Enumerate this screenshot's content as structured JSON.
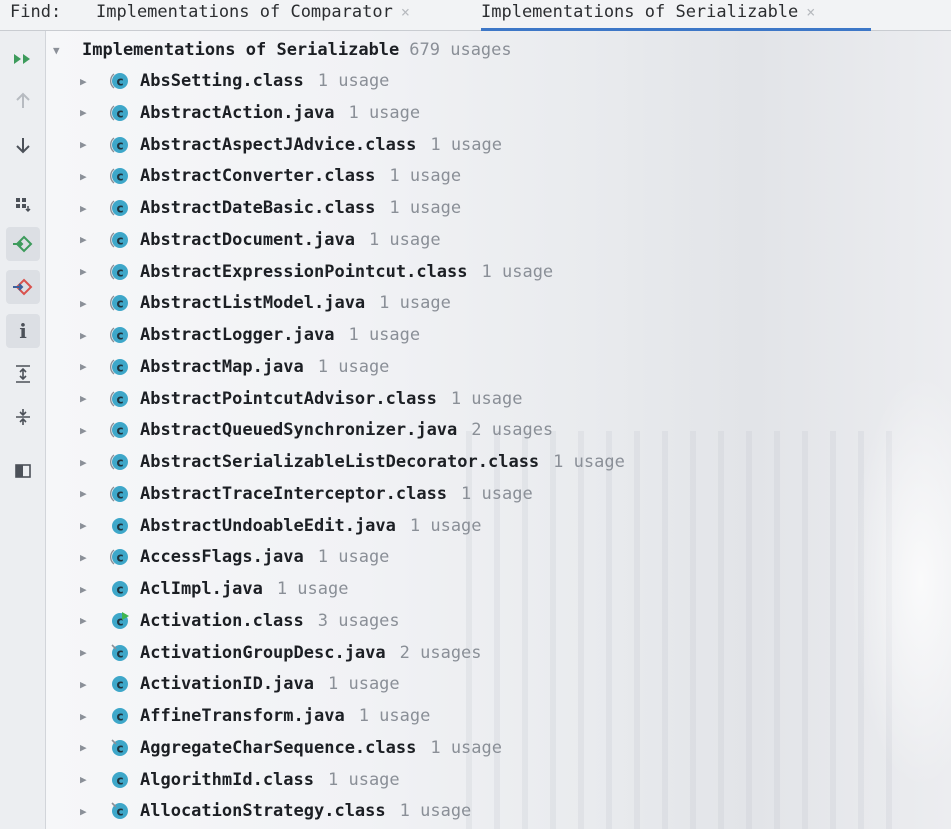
{
  "header": {
    "find_label": "Find:",
    "tabs": [
      {
        "label": "Implementations of Comparator",
        "close": "×",
        "active": false
      },
      {
        "label": "Implementations of Serializable",
        "close": "×",
        "active": true
      }
    ]
  },
  "toolbar": {
    "buttons": [
      {
        "name": "expand-all-icon",
        "toggled": false
      },
      {
        "name": "previous-occurrence-icon",
        "toggled": false
      },
      {
        "name": "next-occurrence-icon",
        "toggled": false
      },
      {
        "name": "group-by-icon",
        "toggled": false
      },
      {
        "name": "show-read-access-icon",
        "toggled": true
      },
      {
        "name": "show-write-access-icon",
        "toggled": true
      },
      {
        "name": "info-icon",
        "toggled": true
      },
      {
        "name": "expand-tree-icon",
        "toggled": false
      },
      {
        "name": "collapse-tree-icon",
        "toggled": false
      },
      {
        "name": "preview-icon",
        "toggled": false
      }
    ]
  },
  "tree": {
    "root": {
      "title": "Implementations of Serializable",
      "count": "679 usages"
    },
    "items": [
      {
        "name": "AbsSetting.class",
        "usage": "1 usage",
        "icon": "class-abstract-icon"
      },
      {
        "name": "AbstractAction.java",
        "usage": "1 usage",
        "icon": "class-abstract-icon"
      },
      {
        "name": "AbstractAspectJAdvice.class",
        "usage": "1 usage",
        "icon": "class-abstract-icon"
      },
      {
        "name": "AbstractConverter.class",
        "usage": "1 usage",
        "icon": "class-abstract-icon"
      },
      {
        "name": "AbstractDateBasic.class",
        "usage": "1 usage",
        "icon": "class-abstract-icon"
      },
      {
        "name": "AbstractDocument.java",
        "usage": "1 usage",
        "icon": "class-abstract-icon"
      },
      {
        "name": "AbstractExpressionPointcut.class",
        "usage": "1 usage",
        "icon": "class-abstract-icon"
      },
      {
        "name": "AbstractListModel.java",
        "usage": "1 usage",
        "icon": "class-abstract-icon"
      },
      {
        "name": "AbstractLogger.java",
        "usage": "1 usage",
        "icon": "class-abstract-icon"
      },
      {
        "name": "AbstractMap.java",
        "usage": "1 usage",
        "icon": "class-abstract-icon"
      },
      {
        "name": "AbstractPointcutAdvisor.class",
        "usage": "1 usage",
        "icon": "class-abstract-icon"
      },
      {
        "name": "AbstractQueuedSynchronizer.java",
        "usage": "2 usages",
        "icon": "class-abstract-icon"
      },
      {
        "name": "AbstractSerializableListDecorator.class",
        "usage": "1 usage",
        "icon": "class-abstract-icon"
      },
      {
        "name": "AbstractTraceInterceptor.class",
        "usage": "1 usage",
        "icon": "class-abstract-icon"
      },
      {
        "name": "AbstractUndoableEdit.java",
        "usage": "1 usage",
        "icon": "class-icon"
      },
      {
        "name": "AccessFlags.java",
        "usage": "1 usage",
        "icon": "class-abstract-icon"
      },
      {
        "name": "AclImpl.java",
        "usage": "1 usage",
        "icon": "class-icon"
      },
      {
        "name": "Activation.class",
        "usage": "3 usages",
        "icon": "class-runnable-icon"
      },
      {
        "name": "ActivationGroupDesc.java",
        "usage": "2 usages",
        "icon": "class-final-icon"
      },
      {
        "name": "ActivationID.java",
        "usage": "1 usage",
        "icon": "class-icon"
      },
      {
        "name": "AffineTransform.java",
        "usage": "1 usage",
        "icon": "class-icon"
      },
      {
        "name": "AggregateCharSequence.class",
        "usage": "1 usage",
        "icon": "class-final-icon"
      },
      {
        "name": "AlgorithmId.class",
        "usage": "1 usage",
        "icon": "class-icon"
      },
      {
        "name": "AllocationStrategy.class",
        "usage": "1 usage",
        "icon": "class-final-icon"
      }
    ]
  },
  "colors": {
    "class_icon": "#3ea7c9",
    "active_tab_underline": "#3d77c7",
    "usage_text": "#8a8f97"
  }
}
